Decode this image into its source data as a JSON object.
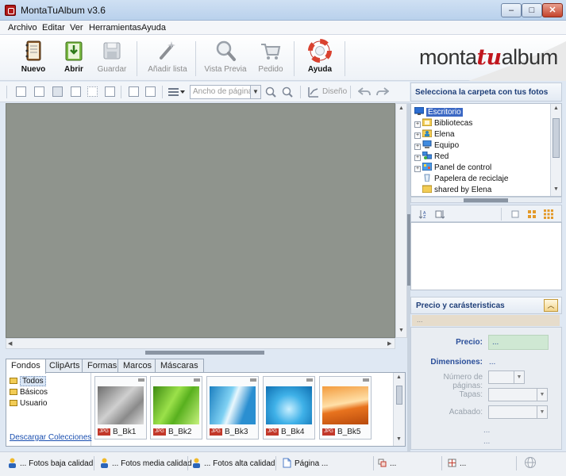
{
  "window": {
    "title": "MontaTuAlbum v3.6",
    "min": "–",
    "max": "□",
    "close": "✕"
  },
  "menu": [
    "Archivo",
    "Editar",
    "Ver",
    "Herramientas",
    "Ayuda"
  ],
  "toolbar": {
    "nuevo": "Nuevo",
    "abrir": "Abrir",
    "guardar": "Guardar",
    "anadir": "Añadir lista",
    "vista": "Vista Previa",
    "pedido": "Pedido",
    "ayuda": "Ayuda"
  },
  "brand": {
    "part1": "monta",
    "part2": "tu",
    "part3": "album"
  },
  "toolbar2": {
    "zoom_placeholder": "Ancho de página",
    "diseno": "Diseño"
  },
  "folder_panel": {
    "title": "Selecciona la carpeta con tus fotos"
  },
  "tree": {
    "root": "Escritorio",
    "items": [
      "Bibliotecas",
      "Elena",
      "Equipo",
      "Red",
      "Panel de control",
      "Papelera de reciclaje",
      "shared by Elena"
    ]
  },
  "bottom": {
    "tabs": [
      "Fondos",
      "ClipArts",
      "Formas",
      "Marcos",
      "Máscaras"
    ],
    "folders": [
      "Todos",
      "Básicos",
      "Usuario"
    ],
    "download": "Descargar Colecciones",
    "thumbs": [
      {
        "tag": "JPG",
        "name": "B_Bk1"
      },
      {
        "tag": "JPG",
        "name": "B_Bk2"
      },
      {
        "tag": "JPG",
        "name": "B_Bk3"
      },
      {
        "tag": "JPG",
        "name": "B_Bk4"
      },
      {
        "tag": "JPG",
        "name": "B_Bk5"
      }
    ]
  },
  "price": {
    "title": "Precio  y carásteristicas",
    "sub": "...",
    "precio_label": "Precio:",
    "precio_value": "...",
    "dim_label": "Dimensiones:",
    "dim_value": "...",
    "paginas_label": "Número de páginas:",
    "tapas_label": "Tapas:",
    "acabado_label": "Acabado:",
    "extra1": "...",
    "extra2": "..."
  },
  "status": {
    "baja": "... Fotos baja calidad",
    "media": "... Fotos media calidad",
    "alta": "... Fotos alta calidad",
    "pagina": "Página ...",
    "s5": "...",
    "s6": "..."
  },
  "colors": {
    "canvas": "#8f948d",
    "brand_red": "#c0161e",
    "selection": "#3b68c4"
  }
}
